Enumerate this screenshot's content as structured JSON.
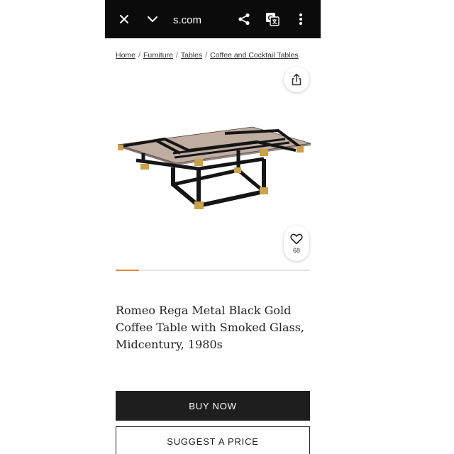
{
  "browser": {
    "url": "s.com",
    "icons": [
      "close-icon",
      "chevron-down-icon",
      "share-icon",
      "translate-icon",
      "more-vert-icon"
    ]
  },
  "breadcrumb": [
    "Home",
    "Furniture",
    "Tables",
    "Coffee and Cocktail Tables"
  ],
  "breadcrumb_separator": "/",
  "product": {
    "title": "Romeo Rega Metal Black Gold Coffee Table with Smoked Glass, Midcentury, 1980s",
    "favorite_count": "68",
    "image_progress": 0.12
  },
  "actions": {
    "buy_label": "BUY NOW",
    "suggest_label": "SUGGEST A PRICE"
  },
  "colors": {
    "accent": "#e8883a",
    "button_dark": "#1e1e1e",
    "topbar": "#0b0b0b"
  }
}
